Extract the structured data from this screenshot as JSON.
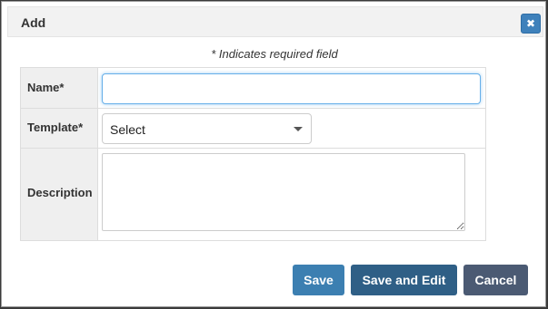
{
  "dialog": {
    "title": "Add",
    "close_icon": "close-icon"
  },
  "form": {
    "required_note": "* Indicates required field",
    "fields": {
      "name": {
        "label": "Name*",
        "value": "",
        "placeholder": ""
      },
      "template": {
        "label": "Template*",
        "selected": "Select"
      },
      "description": {
        "label": "Description",
        "value": ""
      }
    }
  },
  "buttons": {
    "save": "Save",
    "save_and_edit": "Save and Edit",
    "cancel": "Cancel"
  },
  "colors": {
    "accent": "#3f81bb",
    "save_button": "#3c7fb1",
    "save_edit_button": "#2f5f86",
    "cancel_button": "#4b5a73"
  }
}
